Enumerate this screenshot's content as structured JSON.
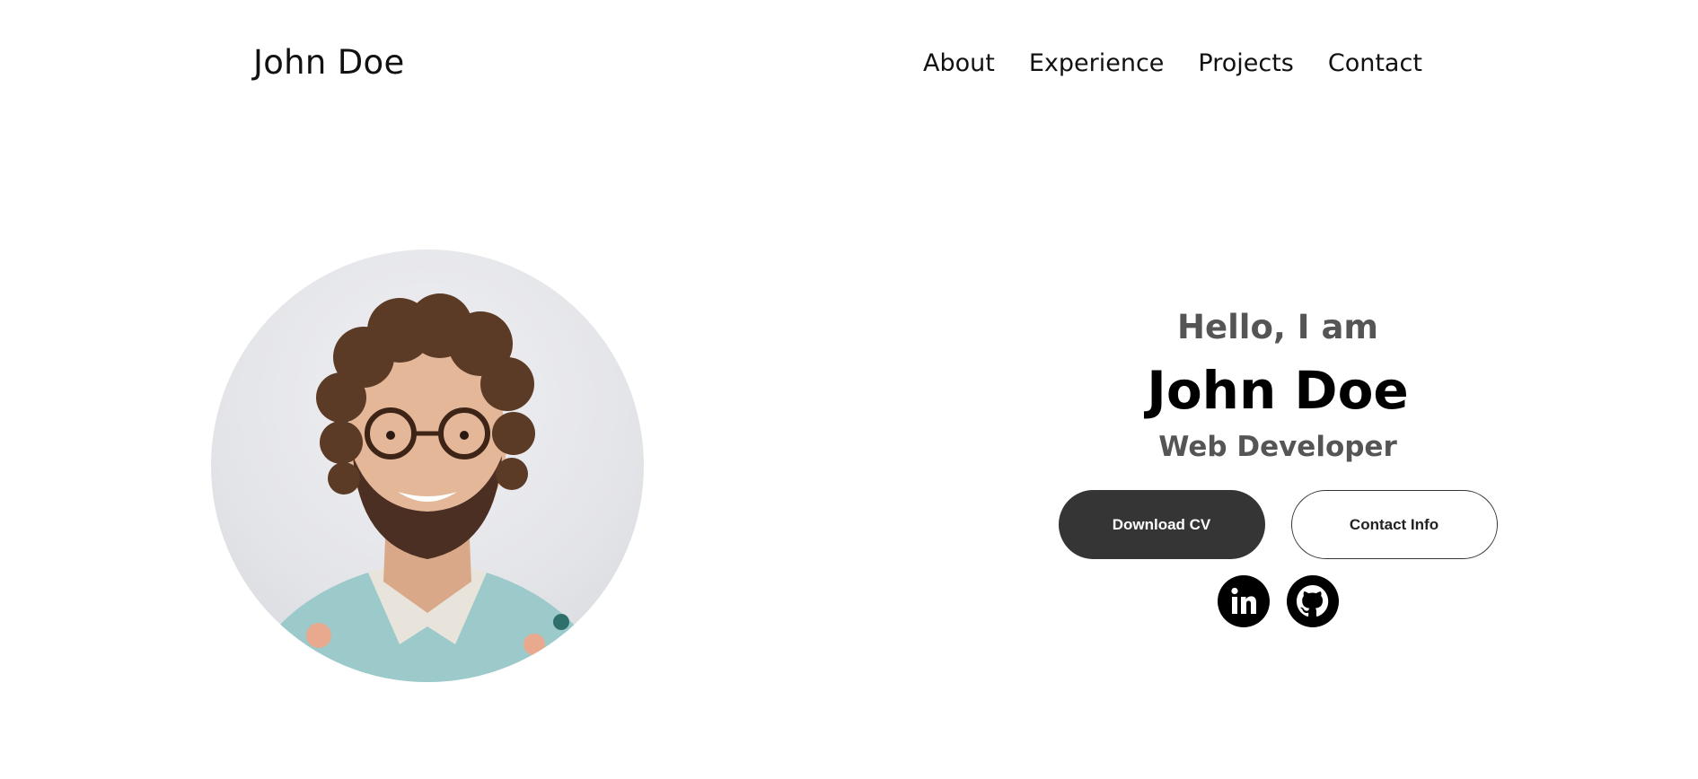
{
  "header": {
    "logo": "John Doe",
    "nav": [
      {
        "label": "About"
      },
      {
        "label": "Experience"
      },
      {
        "label": "Projects"
      },
      {
        "label": "Contact"
      }
    ]
  },
  "hero": {
    "greeting": "Hello, I am",
    "name": "John Doe",
    "role": "Web Developer",
    "buttons": {
      "download_cv": "Download CV",
      "contact_info": "Contact Info"
    },
    "socials": [
      {
        "icon": "linkedin-icon"
      },
      {
        "icon": "github-icon"
      }
    ]
  },
  "profile_photo": {
    "icon": "profile-photo"
  },
  "colors": {
    "primary_button": "#353535",
    "muted_text": "#555555"
  }
}
